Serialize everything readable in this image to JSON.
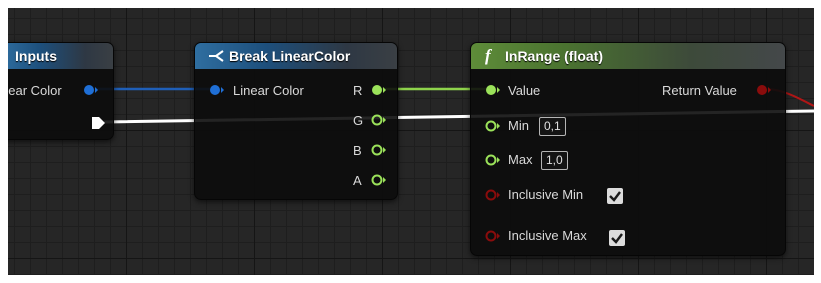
{
  "nodes": {
    "inputs": {
      "title": "Inputs",
      "pin_label": "near Color",
      "header_color": "#2f6ea0"
    },
    "break": {
      "title": "Break LinearColor",
      "header_icon": "break-struct-icon",
      "input_label": "Linear Color",
      "outputs": [
        "R",
        "G",
        "B",
        "A"
      ],
      "header_color": "#2f6ea0"
    },
    "inrange": {
      "title": "InRange (float)",
      "header_icon": "function-icon",
      "header_icon_glyph": "f",
      "value_label": "Value",
      "min_label": "Min",
      "min_value": "0,1",
      "max_label": "Max",
      "max_value": "1,0",
      "inclusive_min_label": "Inclusive Min",
      "inclusive_min_checked": true,
      "inclusive_max_label": "Inclusive Max",
      "inclusive_max_checked": true,
      "return_label": "Return Value",
      "header_color": "#5e8c39"
    }
  },
  "colors": {
    "struct_pin": "#1f6fd6",
    "float_pin": "#9be25a",
    "bool_pin": "#8a0c0c",
    "exec": "#ffffff",
    "grid_bg": "#262626"
  }
}
